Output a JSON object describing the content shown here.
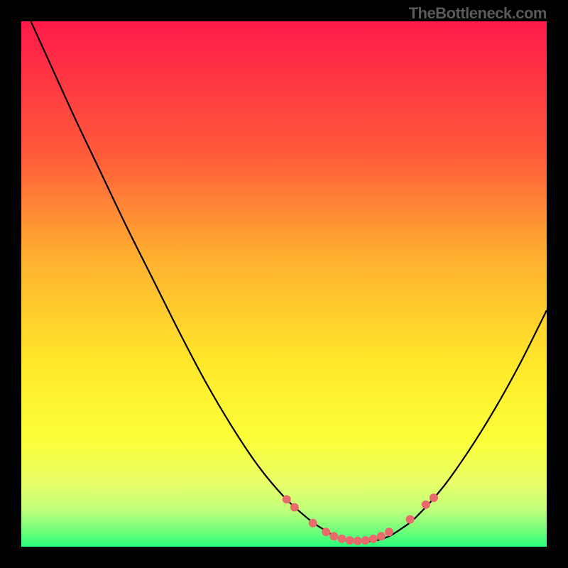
{
  "watermark": "TheBottleneck.com",
  "chart_data": {
    "type": "line",
    "title": "",
    "xlabel": "",
    "ylabel": "",
    "xlim": [
      0,
      100
    ],
    "ylim": [
      0,
      100
    ],
    "background_gradient": {
      "stops": [
        {
          "pos": 0,
          "color": "#ff1a4a"
        },
        {
          "pos": 25,
          "color": "#ff5a3a"
        },
        {
          "pos": 45,
          "color": "#ffb030"
        },
        {
          "pos": 65,
          "color": "#ffe82a"
        },
        {
          "pos": 80,
          "color": "#fbff3a"
        },
        {
          "pos": 88,
          "color": "#e8ff6a"
        },
        {
          "pos": 93,
          "color": "#c0ff7a"
        },
        {
          "pos": 97,
          "color": "#70ff7a"
        },
        {
          "pos": 100,
          "color": "#2aff7a"
        }
      ]
    },
    "series": [
      {
        "name": "bottleneck-curve",
        "color": "#000000",
        "x": [
          0,
          5,
          10,
          15,
          20,
          25,
          30,
          35,
          40,
          45,
          50,
          55,
          58,
          60,
          62,
          64,
          66,
          68,
          70,
          72,
          75,
          80,
          85,
          90,
          95,
          100
        ],
        "y": [
          104,
          93,
          82,
          71.5,
          61,
          51,
          41,
          31.5,
          23,
          15.5,
          9.5,
          5,
          3,
          1.8,
          1.2,
          1,
          1,
          1.3,
          2,
          3.2,
          5.5,
          11,
          18,
          26,
          35,
          45
        ]
      }
    ],
    "markers": {
      "name": "highlight-dots",
      "color": "#e86a6a",
      "radius": 6,
      "points": [
        {
          "x": 50.5,
          "y": 9.0
        },
        {
          "x": 52.0,
          "y": 7.5
        },
        {
          "x": 55.5,
          "y": 4.5
        },
        {
          "x": 58.0,
          "y": 2.8
        },
        {
          "x": 59.5,
          "y": 2.0
        },
        {
          "x": 61.0,
          "y": 1.5
        },
        {
          "x": 62.5,
          "y": 1.2
        },
        {
          "x": 64.0,
          "y": 1.1
        },
        {
          "x": 65.5,
          "y": 1.2
        },
        {
          "x": 67.0,
          "y": 1.5
        },
        {
          "x": 68.5,
          "y": 2.0
        },
        {
          "x": 70.0,
          "y": 2.8
        },
        {
          "x": 74.0,
          "y": 5.2
        },
        {
          "x": 77.0,
          "y": 8.0
        },
        {
          "x": 78.5,
          "y": 9.3
        }
      ]
    }
  }
}
